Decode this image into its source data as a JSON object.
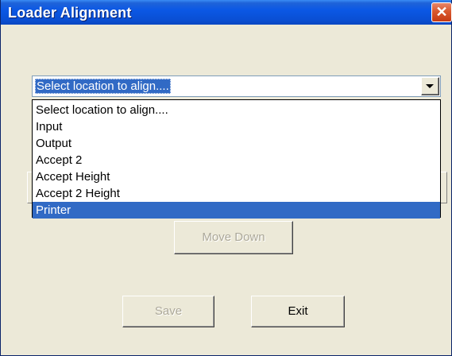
{
  "window": {
    "title": "Loader Alignment",
    "close_glyph": "✕"
  },
  "location_select": {
    "selected": "Select location to align....",
    "options": [
      "Select location to align....",
      "Input",
      "Output",
      "Accept 2",
      "Accept Height",
      "Accept 2 Height",
      "Printer"
    ],
    "highlighted_option": "Printer"
  },
  "buttons": {
    "move_down": "Move Down",
    "save": "Save",
    "exit": "Exit"
  },
  "colors": {
    "titlebar": "#0a4fd4",
    "selection": "#316ac5",
    "dialog_bg": "#ece9d8",
    "close_button": "#d9582e"
  }
}
